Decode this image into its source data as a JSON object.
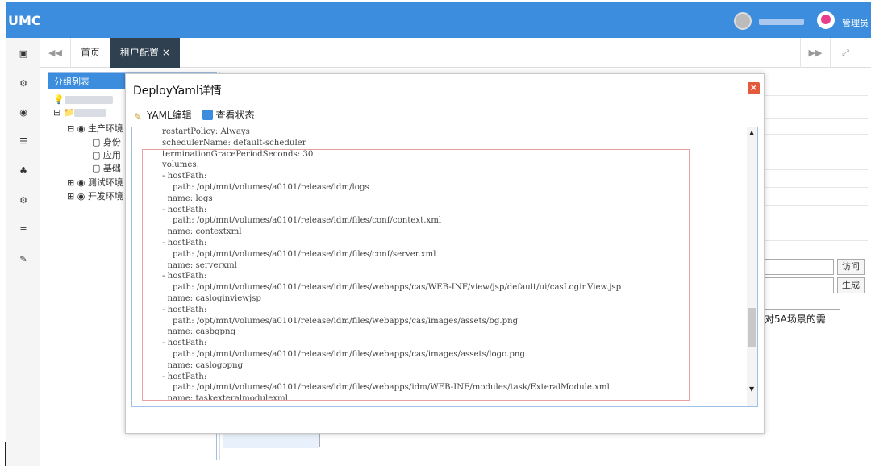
{
  "app": {
    "logo": "UMC",
    "role": "管理员"
  },
  "sidebar": {
    "icons": [
      "id-card-icon",
      "gears-icon",
      "eye-icon",
      "list-icon",
      "sitemap-icon",
      "gear-icon",
      "menu-icon",
      "wrench-icon"
    ]
  },
  "tabs": [
    {
      "label": "首页"
    },
    {
      "label": "租户配置 ×"
    }
  ],
  "group": {
    "title": "分组列表",
    "tree": [
      "生产环境",
      "身份",
      "应用",
      "基础",
      "测试环境",
      "开发环境"
    ]
  },
  "right": {
    "visit": "访问",
    "generate": "生成",
    "text": "对5A场景的需"
  },
  "modal": {
    "title": "DeployYaml详情",
    "tools": [
      "YAML编辑",
      "查看状态"
    ],
    "code": [
      "restartPolicy: Always",
      "schedulerName: default-scheduler",
      "terminationGracePeriodSeconds: 30",
      "volumes:",
      "- hostPath:",
      "    path: /opt/mnt/volumes/a0101/release/idm/logs",
      "  name: logs",
      "- hostPath:",
      "    path: /opt/mnt/volumes/a0101/release/idm/files/conf/context.xml",
      "  name: contextxml",
      "- hostPath:",
      "    path: /opt/mnt/volumes/a0101/release/idm/files/conf/server.xml",
      "  name: serverxml",
      "- hostPath:",
      "    path: /opt/mnt/volumes/a0101/release/idm/files/webapps/cas/WEB-INF/view/jsp/default/ui/casLoginView.jsp",
      "  name: casloginviewjsp",
      "- hostPath:",
      "    path: /opt/mnt/volumes/a0101/release/idm/files/webapps/cas/images/assets/bg.png",
      "  name: casbgpng",
      "- hostPath:",
      "    path: /opt/mnt/volumes/a0101/release/idm/files/webapps/cas/images/assets/logo.png",
      "  name: caslogopng",
      "- hostPath:",
      "    path: /opt/mnt/volumes/a0101/release/idm/files/webapps/idm/WEB-INF/modules/task/ExteralModule.xml",
      "  name: taskexteralmodulexml",
      "- hostPath:"
    ]
  }
}
